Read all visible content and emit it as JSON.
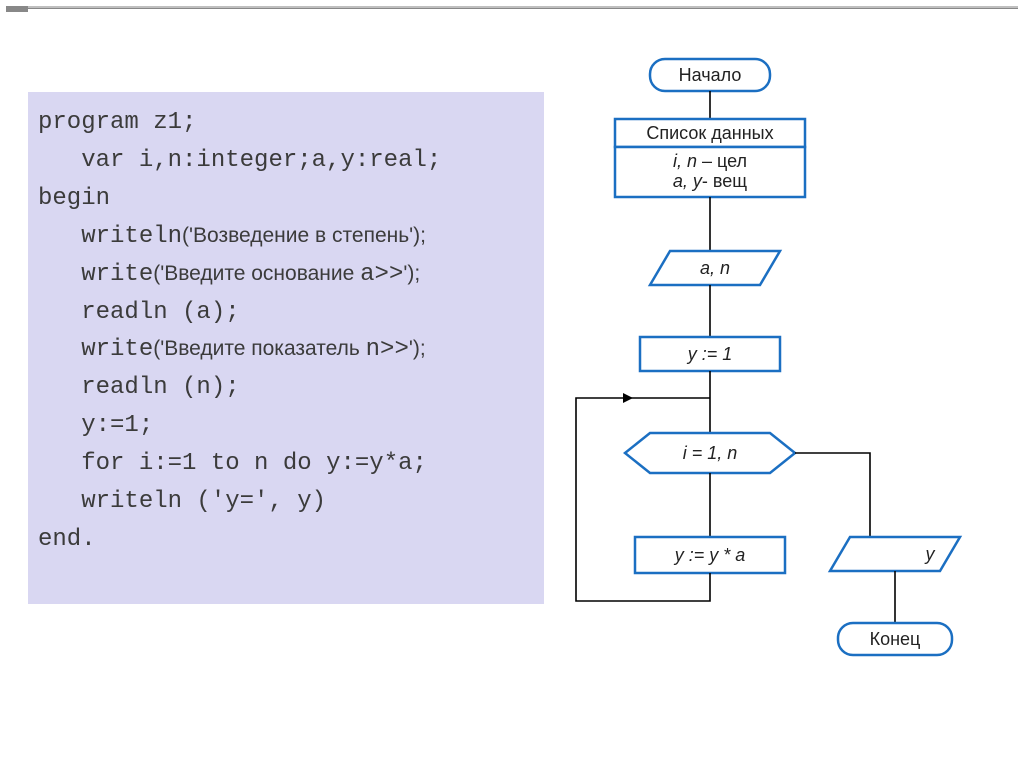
{
  "code": {
    "l1_a": "program",
    "l1_b": " z1;",
    "l2_a": "   var",
    "l2_b": " i,n:integer;a,y:real;",
    "l3_a": "begin",
    "l4_a": "   writeln",
    "l4_b": "('Возведение в степень');",
    "l5_a": "   write",
    "l5_b": "('Введите основание ",
    "l5_c": "a>>",
    "l5_d": "');",
    "l6_a": "   readln (a);",
    "l7_a": "   write",
    "l7_b": "('Введите показатель ",
    "l7_c": "n>>",
    "l7_d": "');",
    "l8_a": "   readln (n);",
    "l9_a": "   y:=1;",
    "l10_a": "   for",
    "l10_b": " i:=1 ",
    "l10_c": "to",
    "l10_d": " n ",
    "l10_e": "do",
    "l10_f": " y:=y*a;",
    "l11_a": "   writeln ('y=', y)",
    "l12_a": "end."
  },
  "flow": {
    "start": "Начало",
    "data_title": "Список данных",
    "data_line1a": "i, n",
    "data_line1b": " – цел",
    "data_line2a": "a, y",
    "data_line2b": "- вещ",
    "io_in_a": "a, n",
    "proc1": "y := 1",
    "loop": "i = 1, n",
    "proc2": "y := y * a",
    "io_out": "y",
    "end": "Конец"
  }
}
